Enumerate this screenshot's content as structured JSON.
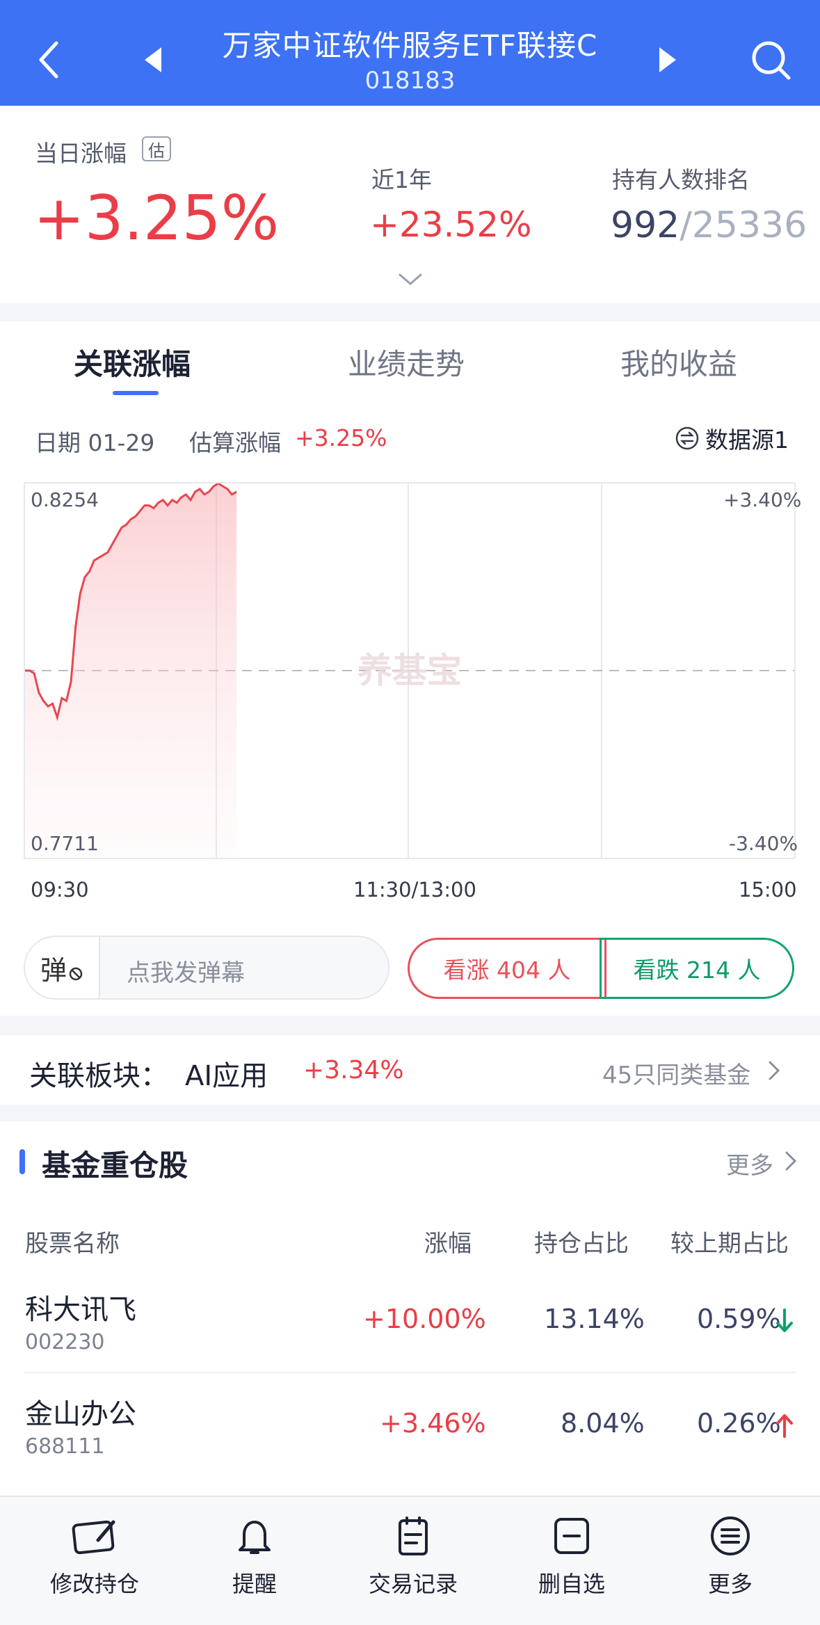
{
  "header": {
    "title": "万家中证软件服务ETF联接C",
    "code": "018183"
  },
  "summary": {
    "daily_label": "当日涨幅",
    "est_badge": "估",
    "daily_change": "+3.25%",
    "year_label": "近1年",
    "year_change": "+23.52%",
    "rank_label": "持有人数排名",
    "rank_value": "992",
    "rank_total": "/25336"
  },
  "tabs": [
    {
      "label": "关联涨幅"
    },
    {
      "label": "业绩走势"
    },
    {
      "label": "我的收益"
    }
  ],
  "chart_info": {
    "date_text": "日期 01-29",
    "est_label": "估算涨幅",
    "est_value": "+3.25%",
    "source": "数据源1"
  },
  "chart_data": {
    "type": "line",
    "y_left_top": "0.8254",
    "y_left_bottom": "0.7711",
    "y_right_top": "+3.40%",
    "y_right_bottom": "-3.40%",
    "x_labels": [
      "09:30",
      "11:30/13:00",
      "15:00"
    ],
    "ylim": [
      -3.4,
      3.4
    ],
    "watermark": "养基宝",
    "series": [
      {
        "values": [
          0,
          0,
          -0.05,
          -0.4,
          -0.55,
          -0.65,
          -0.6,
          -0.85,
          -0.5,
          -0.55,
          -0.2,
          0.8,
          1.4,
          1.7,
          1.8,
          2.0,
          2.05,
          2.1,
          2.15,
          2.3,
          2.45,
          2.6,
          2.65,
          2.75,
          2.8,
          2.9,
          3.0,
          3.0,
          2.95,
          3.05,
          3.1,
          3.0,
          3.1,
          3.05,
          3.15,
          3.2,
          3.1,
          3.25,
          3.3,
          3.2,
          3.25,
          3.35,
          3.4,
          3.35,
          3.3,
          3.2,
          3.25
        ]
      }
    ]
  },
  "danmu": {
    "badge": "弹",
    "placeholder": "点我发弹幕"
  },
  "votes": {
    "up": "看涨 404 人",
    "down": "看跌 214 人"
  },
  "sector": {
    "label": "关联板块：",
    "name": "AI应用",
    "change": "+3.34%",
    "similar": "45只同类基金"
  },
  "holdings": {
    "title": "基金重仓股",
    "more": "更多",
    "headers": [
      "股票名称",
      "涨幅",
      "持仓占比",
      "较上期占比"
    ],
    "rows": [
      {
        "name": "科大讯飞",
        "code": "002230",
        "change": "+10.00%",
        "weight": "13.14%",
        "delta": "0.59%",
        "direction": "down"
      },
      {
        "name": "金山办公",
        "code": "688111",
        "change": "+3.46%",
        "weight": "8.04%",
        "delta": "0.26%",
        "direction": "up"
      }
    ]
  },
  "tabbar": [
    {
      "label": "修改持仓",
      "icon": "edit-holdings-icon"
    },
    {
      "label": "提醒",
      "icon": "bell-icon"
    },
    {
      "label": "交易记录",
      "icon": "clipboard-icon"
    },
    {
      "label": "删自选",
      "icon": "remove-watchlist-icon"
    },
    {
      "label": "更多",
      "icon": "menu-icon"
    }
  ],
  "colors": {
    "brand_blue": "#3d72f5",
    "up_red": "#ea3d47",
    "down_green": "#0aa36a"
  }
}
